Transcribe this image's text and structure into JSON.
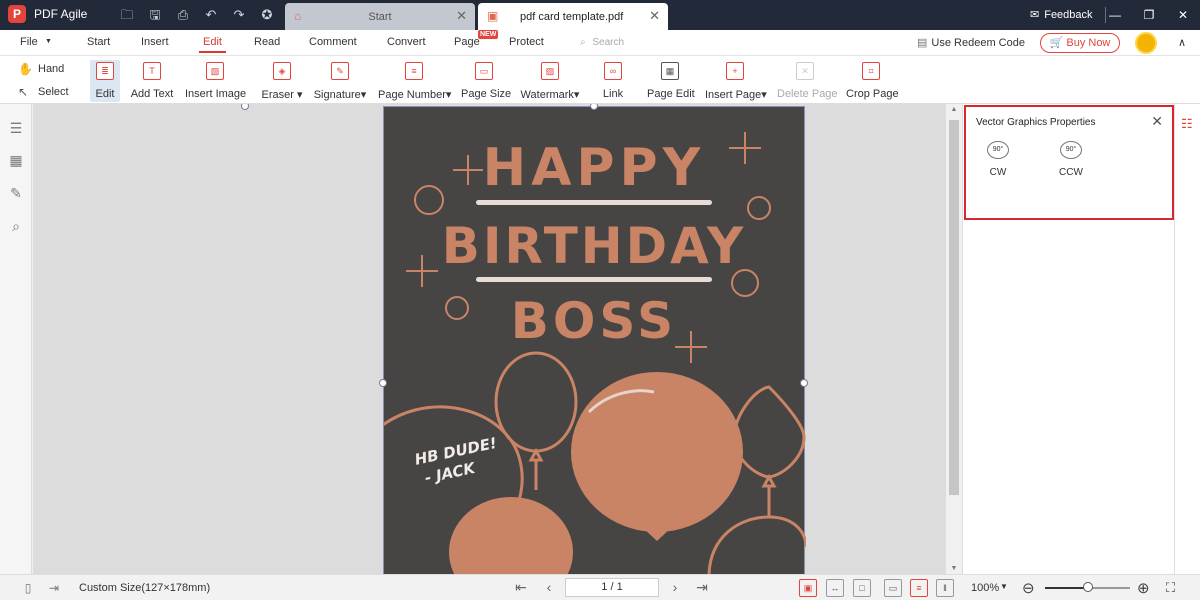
{
  "app": {
    "name": "PDF Agile",
    "logo_letter": "P"
  },
  "titlebar": {
    "quick_icons": [
      "open-folder-icon",
      "save-icon",
      "print-icon",
      "undo-icon",
      "redo-icon",
      "star-icon"
    ],
    "tabs": [
      {
        "label": "Start",
        "icon": "home-icon",
        "active": false
      },
      {
        "label": "pdf card template.pdf",
        "icon": "pdf-file-icon",
        "active": true
      }
    ],
    "feedback_label": "Feedback"
  },
  "menubar": {
    "items": [
      "File",
      "Start",
      "Insert",
      "Edit",
      "Read",
      "Comment",
      "Convert",
      "Page",
      "Protect"
    ],
    "active": "Edit",
    "new_badge": "NEW",
    "search_placeholder": "Search",
    "redeem_label": "Use Redeem Code",
    "buy_label": "Buy Now"
  },
  "toolbar": {
    "hand_label": "Hand",
    "select_label": "Select",
    "tools": [
      {
        "label": "Edit",
        "active": true
      },
      {
        "label": "Add Text"
      },
      {
        "label": "Insert Image"
      },
      {
        "label": "Eraser",
        "dropdown": true
      },
      {
        "label": "Signature",
        "dropdown": true
      },
      {
        "label": "Page Number",
        "dropdown": true
      },
      {
        "label": "Page Size"
      },
      {
        "label": "Watermark",
        "dropdown": true
      },
      {
        "label": "Link"
      },
      {
        "label": "Page Edit"
      },
      {
        "label": "Insert Page",
        "dropdown": true
      },
      {
        "label": "Delete Page",
        "disabled": true
      },
      {
        "label": "Crop Page"
      }
    ]
  },
  "card": {
    "line1": "HAPPY",
    "line2": "BIRTHDAY",
    "line3": "BOSS",
    "handwriting1": "HB DUDE!",
    "handwriting2": "- JACK",
    "colors": {
      "background": "#474444",
      "accent": "#c98466"
    }
  },
  "panel": {
    "title": "Vector Graphics Properties",
    "rotate_cw_label": "CW",
    "rotate_ccw_label": "CCW",
    "rotate_value": "90°"
  },
  "statusbar": {
    "page_size": "Custom Size(127×178mm)",
    "page_indicator": "1 / 1",
    "zoom": "100%",
    "zoom_fraction": 0.5
  },
  "colors": {
    "brand": "#e2453c",
    "titlebar": "#222a3a",
    "panel_highlight": "#d9262c"
  }
}
